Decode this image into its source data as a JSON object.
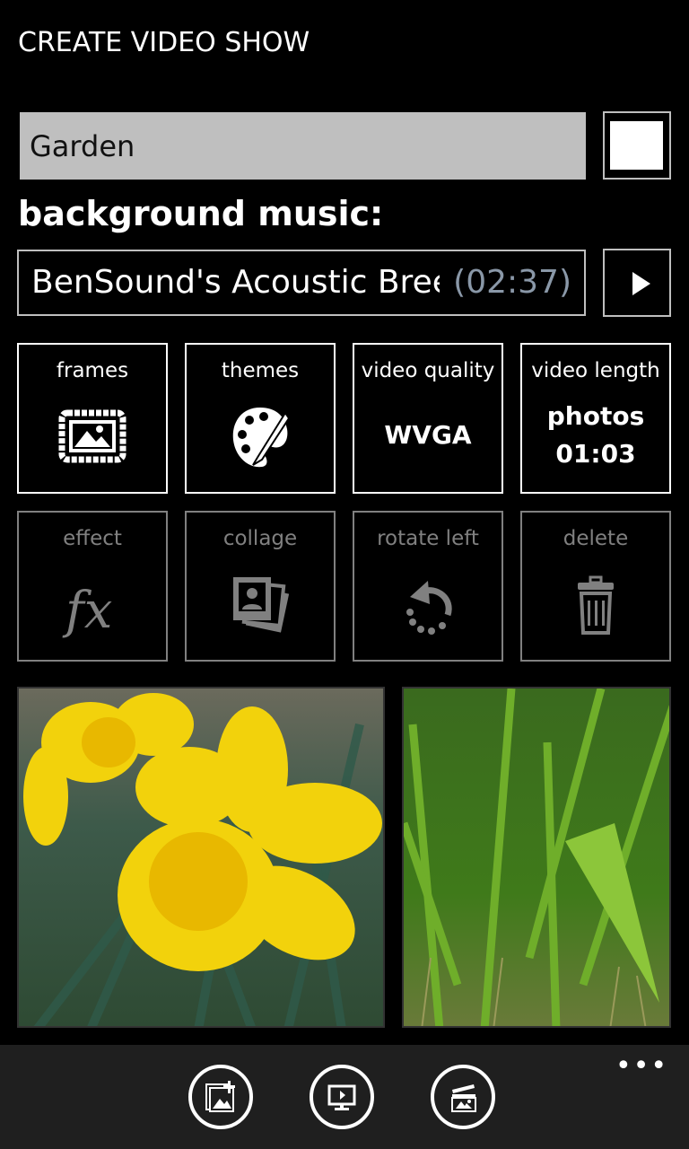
{
  "header": {
    "title": "CREATE VIDEO SHOW"
  },
  "show": {
    "name_value": "Garden",
    "checkbox_checked": false
  },
  "music": {
    "label": "background music:",
    "track_title": "BenSound's Acoustic Breeze",
    "duration": "(02:37)",
    "play_icon": "play-icon"
  },
  "tiles_row1": [
    {
      "label": "frames",
      "icon": "picture-frame-icon"
    },
    {
      "label": "themes",
      "icon": "palette-icon"
    },
    {
      "label": "video quality",
      "value": "WVGA"
    },
    {
      "label": "video length",
      "value_line1": "photos",
      "value_line2": "01:03"
    }
  ],
  "tiles_row2": [
    {
      "label": "effect",
      "icon": "fx-icon",
      "enabled": false
    },
    {
      "label": "collage",
      "icon": "collage-icon",
      "enabled": false
    },
    {
      "label": "rotate left",
      "icon": "rotate-left-icon",
      "enabled": false
    },
    {
      "label": "delete",
      "icon": "trash-icon",
      "enabled": false
    }
  ],
  "photos": [
    {
      "subject": "yellow daffodils"
    },
    {
      "subject": "green grass leaves"
    }
  ],
  "appbar": {
    "buttons": [
      {
        "icon": "add-photos-icon"
      },
      {
        "icon": "preview-monitor-icon"
      },
      {
        "icon": "create-video-clapper-icon"
      }
    ],
    "more_label": "•••"
  },
  "colors": {
    "background": "#000000",
    "input_bg": "#bfbfbf",
    "disabled": "#808080",
    "duration_text": "#8a98a8",
    "appbar_bg": "#1f1f1f"
  }
}
